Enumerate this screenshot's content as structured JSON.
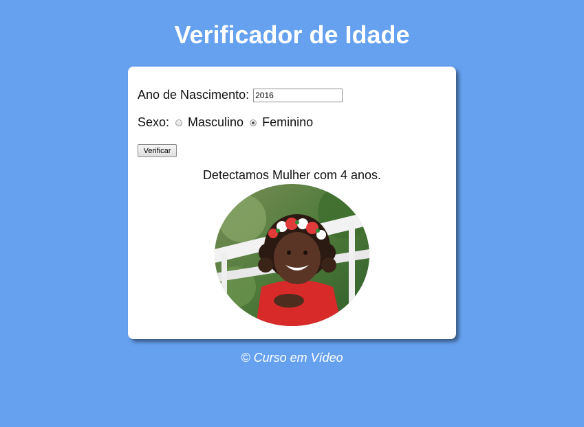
{
  "header": {
    "title": "Verificador de Idade"
  },
  "form": {
    "year_label": "Ano de Nascimento:",
    "year_value": "2016",
    "sex_label": "Sexo:",
    "options": [
      {
        "label": "Masculino",
        "checked": false
      },
      {
        "label": "Feminino",
        "checked": true
      }
    ],
    "button_label": "Verificar"
  },
  "result": {
    "text": "Detectamos Mulher com 4 anos.",
    "image_subject": "smiling girl with flower crown in red dress"
  },
  "footer": {
    "text": "© Curso em Vídeo"
  },
  "colors": {
    "background": "#66a1f0",
    "card": "#ffffff",
    "header_text": "#ffffff"
  }
}
